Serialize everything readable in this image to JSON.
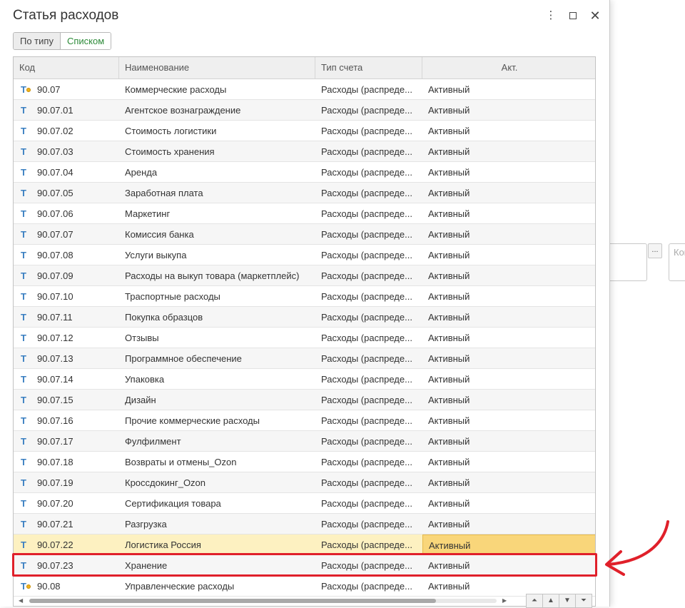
{
  "window": {
    "title": "Статья расходов",
    "more_icon": "⋮",
    "maximize_icon": "square-icon",
    "close_icon": "✕"
  },
  "view_toggle": {
    "by_type": "По типу",
    "as_list": "Списком",
    "active": "as_list"
  },
  "table": {
    "columns": [
      "Код",
      "Наименование",
      "Тип счета",
      "Акт."
    ],
    "rows": [
      {
        "code": "90.07",
        "name": "Коммерческие расходы",
        "type": "Расходы (распреде...",
        "act": "Активный",
        "group": true
      },
      {
        "code": "90.07.01",
        "name": "Агентское вознаграждение",
        "type": "Расходы (распреде...",
        "act": "Активный"
      },
      {
        "code": "90.07.02",
        "name": "Стоимость логистики",
        "type": "Расходы (распреде...",
        "act": "Активный"
      },
      {
        "code": "90.07.03",
        "name": "Стоимость хранения",
        "type": "Расходы (распреде...",
        "act": "Активный"
      },
      {
        "code": "90.07.04",
        "name": "Аренда",
        "type": "Расходы (распреде...",
        "act": "Активный"
      },
      {
        "code": "90.07.05",
        "name": "Заработная плата",
        "type": "Расходы (распреде...",
        "act": "Активный"
      },
      {
        "code": "90.07.06",
        "name": "Маркетинг",
        "type": "Расходы (распреде...",
        "act": "Активный"
      },
      {
        "code": "90.07.07",
        "name": "Комиссия банка",
        "type": "Расходы (распреде...",
        "act": "Активный"
      },
      {
        "code": "90.07.08",
        "name": "Услуги выкупа",
        "type": "Расходы (распреде...",
        "act": "Активный"
      },
      {
        "code": "90.07.09",
        "name": "Расходы на выкуп товара (маркетплейс)",
        "type": "Расходы (распреде...",
        "act": "Активный"
      },
      {
        "code": "90.07.10",
        "name": "Траспортные расходы",
        "type": "Расходы (распреде...",
        "act": "Активный"
      },
      {
        "code": "90.07.11",
        "name": "Покупка образцов",
        "type": "Расходы (распреде...",
        "act": "Активный"
      },
      {
        "code": "90.07.12",
        "name": "Отзывы",
        "type": "Расходы (распреде...",
        "act": "Активный"
      },
      {
        "code": "90.07.13",
        "name": "Программное обеспечение",
        "type": "Расходы (распреде...",
        "act": "Активный"
      },
      {
        "code": "90.07.14",
        "name": "Упаковка",
        "type": "Расходы (распреде...",
        "act": "Активный"
      },
      {
        "code": "90.07.15",
        "name": "Дизайн",
        "type": "Расходы (распреде...",
        "act": "Активный"
      },
      {
        "code": "90.07.16",
        "name": "Прочие коммерческие расходы",
        "type": "Расходы (распреде...",
        "act": "Активный"
      },
      {
        "code": "90.07.17",
        "name": "Фулфилмент",
        "type": "Расходы (распреде...",
        "act": "Активный"
      },
      {
        "code": "90.07.18",
        "name": "Возвраты и отмены_Ozon",
        "type": "Расходы (распреде...",
        "act": "Активный"
      },
      {
        "code": "90.07.19",
        "name": "Кроссдокинг_Ozon",
        "type": "Расходы (распреде...",
        "act": "Активный"
      },
      {
        "code": "90.07.20",
        "name": "Сертификация товара",
        "type": "Расходы (распреде...",
        "act": "Активный"
      },
      {
        "code": "90.07.21",
        "name": "Разгрузка",
        "type": "Расходы (распреде...",
        "act": "Активный"
      },
      {
        "code": "90.07.22",
        "name": "Логистика Россия",
        "type": "Расходы (распреде...",
        "act": "Активный",
        "selected": true
      },
      {
        "code": "90.07.23",
        "name": "Хранение",
        "type": "Расходы (распреде...",
        "act": "Активный",
        "highlighted": true
      },
      {
        "code": "90.08",
        "name": "Управленческие расходы",
        "type": "Расходы (распреде...",
        "act": "Активный",
        "group": true
      }
    ]
  },
  "background": {
    "dots_button": "...",
    "partial_field_text": "Ком"
  },
  "colors": {
    "accent_green": "#2e8b3a",
    "selection_row": "#fdf1c1",
    "selection_cell": "#f9d67a",
    "annotation_red": "#e0202a",
    "icon_blue": "#3a7fc1"
  }
}
